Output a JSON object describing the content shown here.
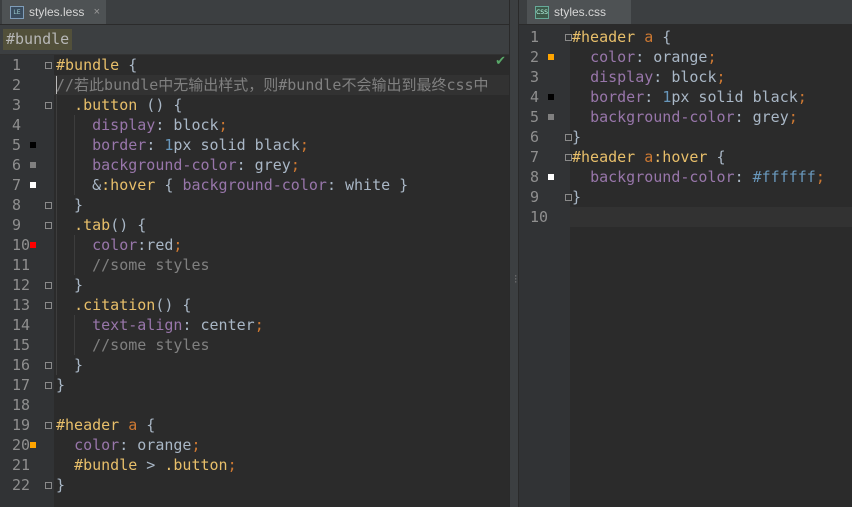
{
  "left": {
    "tab": {
      "label": "styles.less",
      "icon": "less-file-icon",
      "close": "×"
    },
    "breadcrumb": "#bundle",
    "lines": [
      {
        "n": "1",
        "segs": [
          [
            "t-class",
            "#bundle"
          ],
          [
            "t-val",
            " "
          ],
          [
            "t-val",
            "{"
          ]
        ]
      },
      {
        "n": "2",
        "segs": [
          [
            "t-com",
            "//若此bundle中无输出样式，则#bundle不会输出到最终css中"
          ]
        ]
      },
      {
        "n": "3",
        "segs": [
          [
            "t-val",
            "  "
          ],
          [
            "t-class",
            ".button"
          ],
          [
            "t-val",
            " () {"
          ]
        ]
      },
      {
        "n": "4",
        "segs": [
          [
            "t-val",
            "    "
          ],
          [
            "t-prop",
            "display"
          ],
          [
            "t-val",
            ": block"
          ],
          [
            "t-punc",
            ";"
          ]
        ]
      },
      {
        "n": "5",
        "segs": [
          [
            "t-val",
            "    "
          ],
          [
            "t-prop",
            "border"
          ],
          [
            "t-val",
            ": "
          ],
          [
            "t-num",
            "1"
          ],
          [
            "t-val",
            "px solid black"
          ],
          [
            "t-punc",
            ";"
          ]
        ]
      },
      {
        "n": "6",
        "segs": [
          [
            "t-val",
            "    "
          ],
          [
            "t-prop",
            "background-color"
          ],
          [
            "t-val",
            ": grey"
          ],
          [
            "t-punc",
            ";"
          ]
        ]
      },
      {
        "n": "7",
        "segs": [
          [
            "t-val",
            "    &"
          ],
          [
            "t-class",
            ":hover"
          ],
          [
            "t-val",
            " { "
          ],
          [
            "t-prop",
            "background-color"
          ],
          [
            "t-val",
            ": white }"
          ]
        ]
      },
      {
        "n": "8",
        "segs": [
          [
            "t-val",
            "  }"
          ]
        ]
      },
      {
        "n": "9",
        "segs": [
          [
            "t-val",
            "  "
          ],
          [
            "t-class",
            ".tab"
          ],
          [
            "t-val",
            "() {"
          ]
        ]
      },
      {
        "n": "10",
        "segs": [
          [
            "t-val",
            "    "
          ],
          [
            "t-prop",
            "color"
          ],
          [
            "t-val",
            ":red"
          ],
          [
            "t-punc",
            ";"
          ]
        ]
      },
      {
        "n": "11",
        "segs": [
          [
            "t-com",
            "    //some styles"
          ]
        ]
      },
      {
        "n": "12",
        "segs": [
          [
            "t-val",
            "  }"
          ]
        ]
      },
      {
        "n": "13",
        "segs": [
          [
            "t-val",
            "  "
          ],
          [
            "t-class",
            ".citation"
          ],
          [
            "t-val",
            "() {"
          ]
        ]
      },
      {
        "n": "14",
        "segs": [
          [
            "t-val",
            "    "
          ],
          [
            "t-prop",
            "text-align"
          ],
          [
            "t-val",
            ": center"
          ],
          [
            "t-punc",
            ";"
          ]
        ]
      },
      {
        "n": "15",
        "segs": [
          [
            "t-com",
            "    //some styles"
          ]
        ]
      },
      {
        "n": "16",
        "segs": [
          [
            "t-val",
            "  }"
          ]
        ]
      },
      {
        "n": "17",
        "segs": [
          [
            "t-val",
            "}"
          ]
        ]
      },
      {
        "n": "18",
        "segs": [
          [
            "t-val",
            ""
          ]
        ]
      },
      {
        "n": "19",
        "segs": [
          [
            "t-class",
            "#header"
          ],
          [
            "t-val",
            " "
          ],
          [
            "t-tag",
            "a"
          ],
          [
            "t-val",
            " {"
          ]
        ]
      },
      {
        "n": "20",
        "segs": [
          [
            "t-val",
            "  "
          ],
          [
            "t-prop",
            "color"
          ],
          [
            "t-val",
            ": orange"
          ],
          [
            "t-punc",
            ";"
          ]
        ]
      },
      {
        "n": "21",
        "segs": [
          [
            "t-val",
            "  "
          ],
          [
            "t-class",
            "#bundle"
          ],
          [
            "t-val",
            " > "
          ],
          [
            "t-class",
            ".button"
          ],
          [
            "t-punc",
            ";"
          ]
        ]
      },
      {
        "n": "22",
        "segs": [
          [
            "t-val",
            "}"
          ]
        ]
      }
    ],
    "markers": [
      {
        "line": 5,
        "color": "#000000"
      },
      {
        "line": 6,
        "color": "#808080"
      },
      {
        "line": 7,
        "color": "#ffffff"
      },
      {
        "line": 10,
        "color": "#ff0000"
      },
      {
        "line": 20,
        "color": "#ffa500"
      }
    ],
    "current_line": 2,
    "status_icon": "checkmark-icon"
  },
  "right": {
    "tab": {
      "label": "styles.css",
      "icon": "css-file-icon"
    },
    "lines": [
      {
        "n": "1",
        "segs": [
          [
            "t-class",
            "#header"
          ],
          [
            "t-val",
            " "
          ],
          [
            "t-tag",
            "a"
          ],
          [
            "t-val",
            " {"
          ]
        ]
      },
      {
        "n": "2",
        "segs": [
          [
            "t-val",
            "  "
          ],
          [
            "t-prop",
            "color"
          ],
          [
            "t-val",
            ": orange"
          ],
          [
            "t-punc",
            ";"
          ]
        ]
      },
      {
        "n": "3",
        "segs": [
          [
            "t-val",
            "  "
          ],
          [
            "t-prop",
            "display"
          ],
          [
            "t-val",
            ": block"
          ],
          [
            "t-punc",
            ";"
          ]
        ]
      },
      {
        "n": "4",
        "segs": [
          [
            "t-val",
            "  "
          ],
          [
            "t-prop",
            "border"
          ],
          [
            "t-val",
            ": "
          ],
          [
            "t-num",
            "1"
          ],
          [
            "t-val",
            "px solid black"
          ],
          [
            "t-punc",
            ";"
          ]
        ]
      },
      {
        "n": "5",
        "segs": [
          [
            "t-val",
            "  "
          ],
          [
            "t-prop",
            "background-color"
          ],
          [
            "t-val",
            ": grey"
          ],
          [
            "t-punc",
            ";"
          ]
        ]
      },
      {
        "n": "6",
        "segs": [
          [
            "t-val",
            "}"
          ]
        ]
      },
      {
        "n": "7",
        "segs": [
          [
            "t-class",
            "#header"
          ],
          [
            "t-val",
            " "
          ],
          [
            "t-tag",
            "a"
          ],
          [
            "t-class",
            ":hover"
          ],
          [
            "t-val",
            " {"
          ]
        ]
      },
      {
        "n": "8",
        "segs": [
          [
            "t-val",
            "  "
          ],
          [
            "t-prop",
            "background-color"
          ],
          [
            "t-val",
            ": "
          ],
          [
            "t-hex",
            "#ffffff"
          ],
          [
            "t-punc",
            ";"
          ]
        ]
      },
      {
        "n": "9",
        "segs": [
          [
            "t-val",
            "}"
          ]
        ]
      },
      {
        "n": "10",
        "segs": [
          [
            "t-val",
            ""
          ]
        ]
      }
    ],
    "markers": [
      {
        "line": 2,
        "color": "#ffa500"
      },
      {
        "line": 4,
        "color": "#000000"
      },
      {
        "line": 5,
        "color": "#808080"
      },
      {
        "line": 8,
        "color": "#ffffff"
      }
    ],
    "current_line": 10
  }
}
